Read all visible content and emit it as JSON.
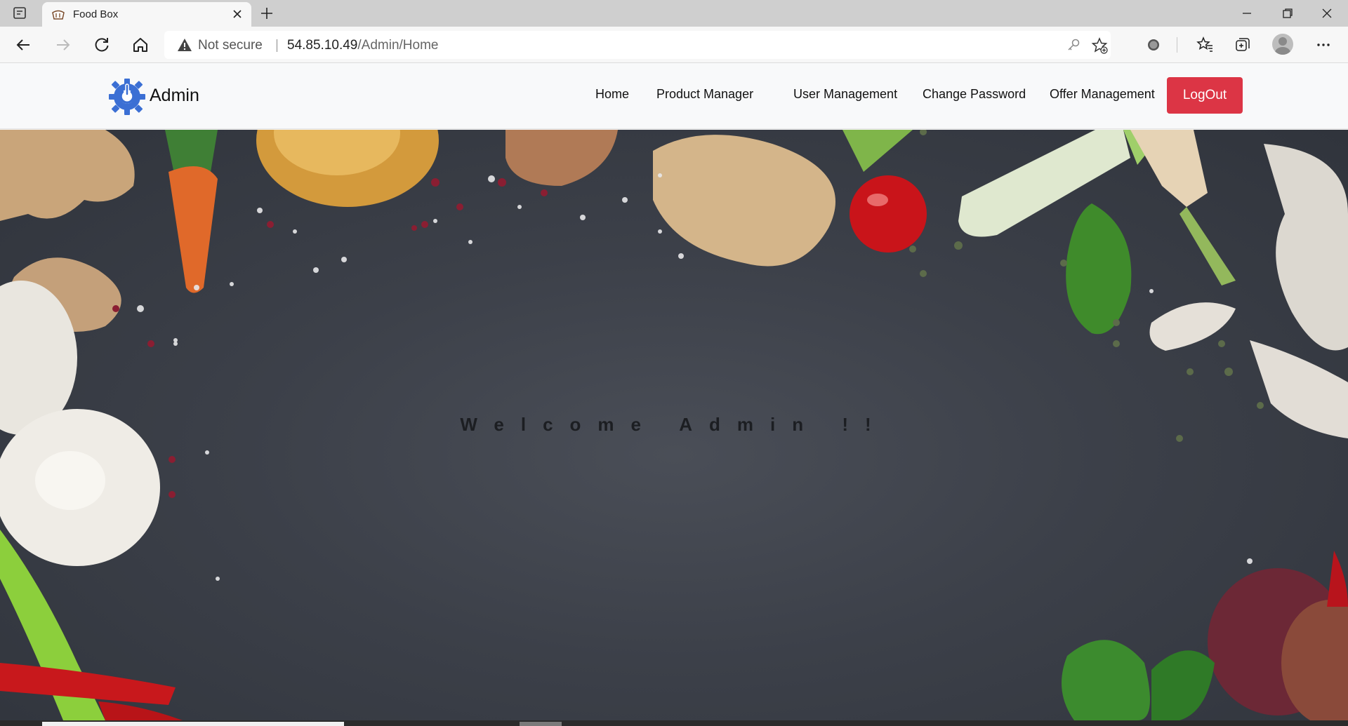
{
  "browser": {
    "tab_title": "Food Box",
    "security_label": "Not secure",
    "url_host": "54.85.10.49",
    "url_path": "/Admin/Home",
    "icons": [
      "tab-actions-icon",
      "page-favicon",
      "close-tab-icon",
      "new-tab-icon",
      "minimize-icon",
      "restore-icon",
      "window-close-icon",
      "back-icon",
      "forward-icon",
      "refresh-icon",
      "home-icon",
      "warning-icon",
      "key-icon",
      "add-favorite-icon",
      "extension-icon",
      "favorites-icon",
      "collections-icon",
      "profile-avatar",
      "more-icon"
    ]
  },
  "site": {
    "brand_text": "Admin",
    "brand_color": "#3b6fd4",
    "nav": {
      "home": "Home",
      "product_manager": "Product Manager",
      "user_management": "User Management",
      "change_password": "Change Password",
      "offer_management": "Offer Management",
      "logout": "LogOut"
    },
    "logout_color": "#dc3545"
  },
  "hero": {
    "welcome_text": "Welcome Admin !!",
    "background": "dark slate with vegetables"
  }
}
